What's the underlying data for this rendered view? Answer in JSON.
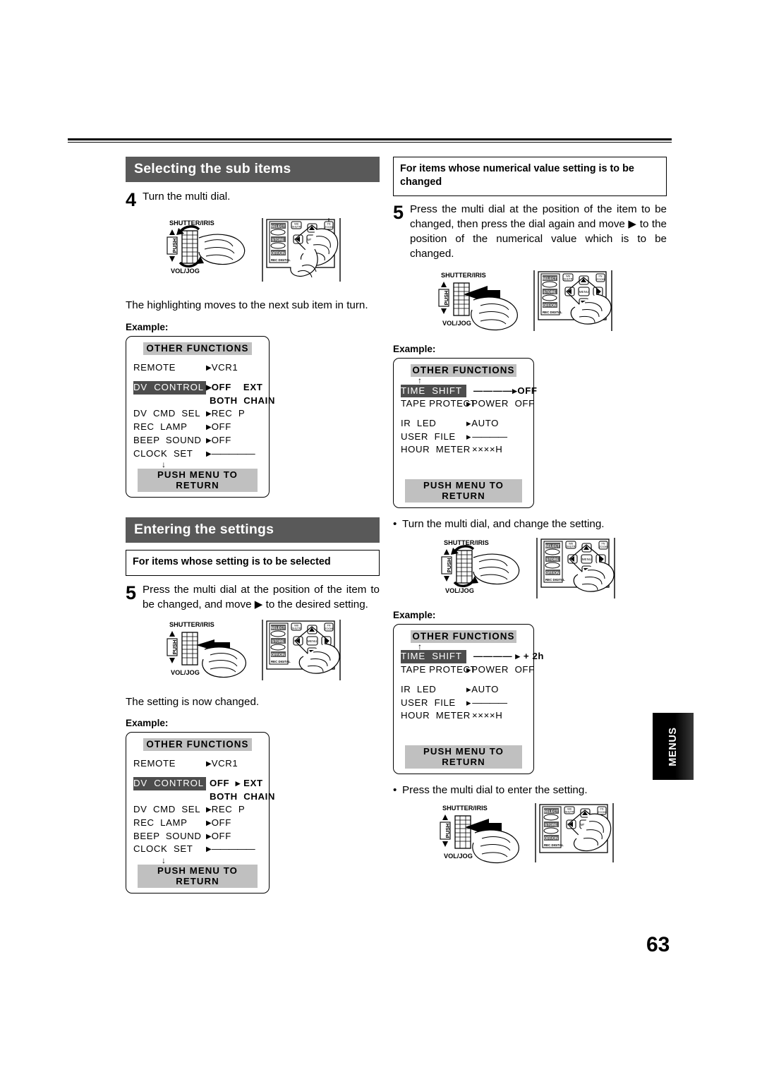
{
  "page": {
    "number": "63",
    "side_tab": "MENUS"
  },
  "left": {
    "section_title": "Selecting the sub items",
    "step4": {
      "num": "4",
      "text": "Turn the multi dial."
    },
    "result_text": "The highlighting moves to the next sub item in turn.",
    "example_label": "Example:",
    "menu1": {
      "title": "OTHER  FUNCTIONS",
      "rows": [
        {
          "label": "REMOTE",
          "arrow_before": true,
          "value": "VCR1",
          "bold": false,
          "highlight": false
        },
        {
          "label": "DV  CONTROL",
          "arrow_before": true,
          "value": "OFF    EXT",
          "value2": "BOTH  CHAIN",
          "bold": true,
          "highlight": true
        },
        {
          "label": "DV  CMD  SEL",
          "arrow_before": true,
          "value": "REC  P",
          "bold": false,
          "highlight": false
        },
        {
          "label": "REC  LAMP",
          "arrow_before": true,
          "value": "OFF",
          "bold": false,
          "highlight": false
        },
        {
          "label": "BEEP  SOUND",
          "arrow_before": true,
          "value": "OFF",
          "bold": false,
          "highlight": false
        },
        {
          "label": "CLOCK  SET",
          "arrow_before": true,
          "value": "—————",
          "bold": false,
          "highlight": false
        }
      ],
      "scroll_down": "↓",
      "footer": "PUSH  MENU  TO  RETURN"
    },
    "section_title2": "Entering the settings",
    "subhead": "For items whose setting is to be selected",
    "step5": {
      "num": "5",
      "text": "Press the multi dial at the position of the item to be changed, and move ▶ to the desired setting."
    },
    "result_text2": "The setting is now changed.",
    "example_label2": "Example:",
    "menu2": {
      "title": "OTHER  FUNCTIONS",
      "rows": [
        {
          "label": "REMOTE",
          "arrow_before": true,
          "value": "VCR1",
          "bold": false,
          "highlight": false
        },
        {
          "label": "DV  CONTROL",
          "arrow_before": false,
          "value": "OFF  ▸ EXT",
          "value2": "BOTH  CHAIN",
          "bold": true,
          "highlight": true
        },
        {
          "label": "DV  CMD  SEL",
          "arrow_before": true,
          "value": "REC  P",
          "bold": false,
          "highlight": false
        },
        {
          "label": "REC  LAMP",
          "arrow_before": true,
          "value": "OFF",
          "bold": false,
          "highlight": false
        },
        {
          "label": "BEEP  SOUND",
          "arrow_before": true,
          "value": "OFF",
          "bold": false,
          "highlight": false
        },
        {
          "label": "CLOCK  SET",
          "arrow_before": true,
          "value": "—————",
          "bold": false,
          "highlight": false
        }
      ],
      "scroll_down": "↓",
      "footer": "PUSH  MENU  TO  RETURN"
    }
  },
  "right": {
    "subhead": "For items whose numerical value setting is to be changed",
    "step5": {
      "num": "5",
      "text": "Press the multi dial at the position of the item to be changed, then press the dial again and move ▶ to the position of the numerical value which is to be changed."
    },
    "example_label": "Example:",
    "menu1": {
      "title": "OTHER  FUNCTIONS",
      "scroll_up": "↑",
      "rows": [
        {
          "label": "TIME  SHIFT",
          "value": "————▸OFF",
          "bold": true,
          "highlight": true
        },
        {
          "label": "TAPE PROTECT",
          "value": "▸POWER  OFF",
          "bold": false,
          "highlight": false
        },
        {
          "label": "",
          "value": "",
          "spacer": true
        },
        {
          "label": "IR  LED",
          "value": "▸AUTO",
          "bold": false,
          "highlight": false
        },
        {
          "label": "USER  FILE",
          "value": "▸ ————",
          "bold": false,
          "highlight": false
        },
        {
          "label": "HOUR  METER",
          "value": "××××H",
          "bold": false,
          "highlight": false
        }
      ],
      "footer": "PUSH  MENU  TO  RETURN"
    },
    "bullet1": "Turn the multi dial, and change the setting.",
    "example_label2": "Example:",
    "menu2": {
      "title": "OTHER  FUNCTIONS",
      "scroll_up": "↑",
      "rows": [
        {
          "label": "TIME  SHIFT",
          "value": "———— ▸ + 2h",
          "bold": true,
          "highlight": true
        },
        {
          "label": "TAPE PROTECT",
          "value": "▸POWER  OFF",
          "bold": false,
          "highlight": false
        },
        {
          "label": "",
          "value": "",
          "spacer": true
        },
        {
          "label": "IR  LED",
          "value": "▸AUTO",
          "bold": false,
          "highlight": false
        },
        {
          "label": "USER  FILE",
          "value": "▸ ————",
          "bold": false,
          "highlight": false
        },
        {
          "label": "HOUR  METER",
          "value": "××××H",
          "bold": false,
          "highlight": false
        }
      ],
      "footer": "PUSH  MENU  TO  RETURN"
    },
    "bullet2": "Press the multi dial to enter the setting."
  },
  "illustration": {
    "dial_top_label": "SHUTTER/IRIS",
    "dial_bottom_label": "VOL/JOG",
    "dial_push_label": "PUSH",
    "remote_buttons": [
      "SELECT",
      "STORE",
      "OFF/ON",
      "REC DIGITAL",
      "WB/SHUTTER",
      "FN ZOOM",
      "MENU",
      "ITEM"
    ]
  }
}
